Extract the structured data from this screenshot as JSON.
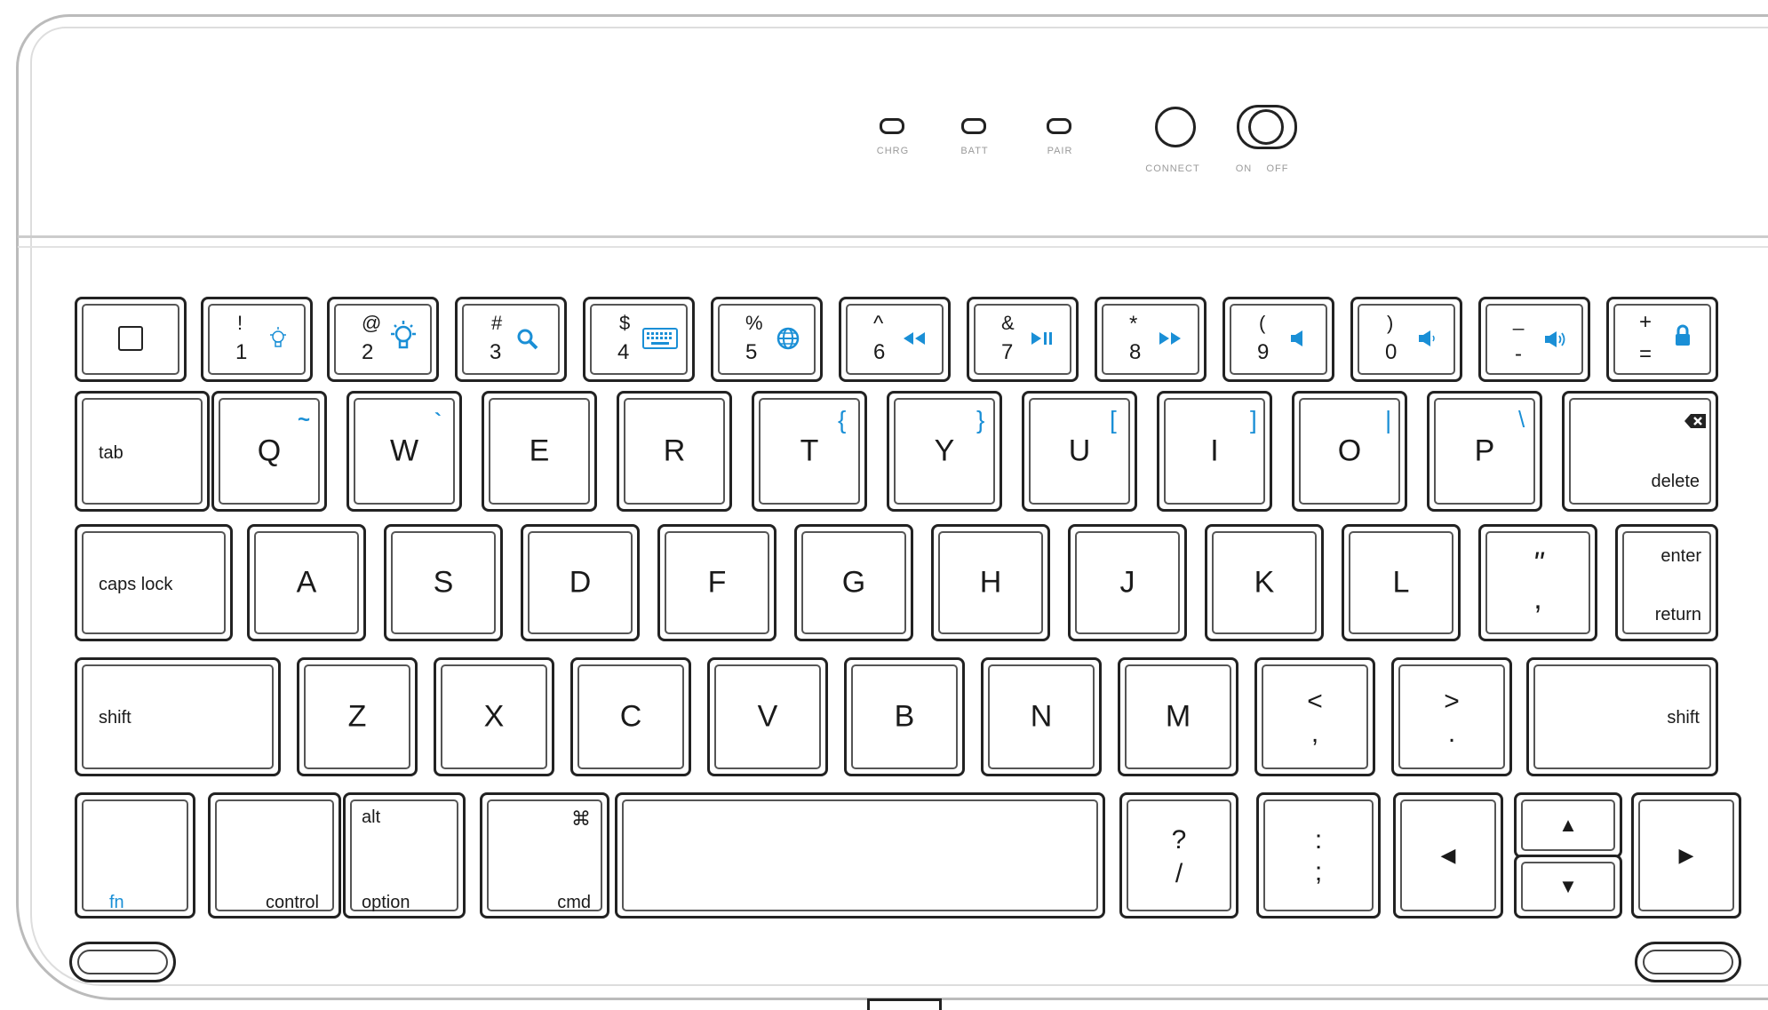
{
  "status_panel": {
    "leds": [
      {
        "label": "CHRG"
      },
      {
        "label": "BATT"
      },
      {
        "label": "PAIR"
      }
    ],
    "connect_label": "CONNECT",
    "power_on_label": "ON",
    "power_off_label": "OFF"
  },
  "colors": {
    "key_outline": "#222222",
    "blue_function": "#1a8fd6",
    "label_gray": "#9a9a9a"
  },
  "keys": {
    "home": {
      "icon": "home-square-icon"
    },
    "k1": {
      "top": "!",
      "bottom": "1",
      "fn_icon": "brightness-down-icon"
    },
    "k2": {
      "top": "@",
      "bottom": "2",
      "fn_icon": "brightness-up-icon"
    },
    "k3": {
      "top": "#",
      "bottom": "3",
      "fn_icon": "search-icon"
    },
    "k4": {
      "top": "$",
      "bottom": "4",
      "fn_icon": "keyboard-icon"
    },
    "k5": {
      "top": "%",
      "bottom": "5",
      "fn_icon": "globe-icon"
    },
    "k6": {
      "top": "^",
      "bottom": "6",
      "fn_icon": "rewind-icon"
    },
    "k7": {
      "top": "&",
      "bottom": "7",
      "fn_icon": "play-pause-icon"
    },
    "k8": {
      "top": "*",
      "bottom": "8",
      "fn_icon": "fast-forward-icon"
    },
    "k9": {
      "top": "(",
      "bottom": "9",
      "fn_icon": "mute-icon"
    },
    "k0": {
      "top": ")",
      "bottom": "0",
      "fn_icon": "volume-down-icon"
    },
    "kminus": {
      "top": "_",
      "bottom": "-",
      "fn_icon": "volume-up-icon"
    },
    "kplus": {
      "top": "+",
      "bottom": "=",
      "fn_icon": "lock-icon"
    },
    "tab": "tab",
    "q": {
      "label": "Q",
      "fn": "~"
    },
    "w": {
      "label": "W",
      "fn": "`"
    },
    "e": {
      "label": "E"
    },
    "r": {
      "label": "R"
    },
    "t": {
      "label": "T",
      "fn": "{"
    },
    "y": {
      "label": "Y",
      "fn": "}"
    },
    "u": {
      "label": "U",
      "fn": "["
    },
    "i": {
      "label": "I",
      "fn": "]"
    },
    "o": {
      "label": "O",
      "fn": "|"
    },
    "p": {
      "label": "P",
      "fn": "\\"
    },
    "delete": "delete",
    "caps": "caps lock",
    "a": "A",
    "s": "S",
    "d": "D",
    "f": "F",
    "g": "G",
    "h": "H",
    "j": "J",
    "k": "K",
    "l": "L",
    "quote": {
      "top": "\"",
      "bottom": ","
    },
    "enter": {
      "top": "enter",
      "bottom": "return"
    },
    "shift_left": "shift",
    "z": "Z",
    "x": "X",
    "c": "C",
    "v": "V",
    "b": "B",
    "n": "N",
    "m": "M",
    "comma": {
      "top": "<",
      "bottom": ","
    },
    "period": {
      "top": ">",
      "bottom": "."
    },
    "shift_right": "shift",
    "fn": "fn",
    "control": "control",
    "option": {
      "top": "alt",
      "bottom": "option"
    },
    "cmd": {
      "top": "⌘",
      "bottom": "cmd"
    },
    "slash": {
      "top": "?",
      "bottom": "/"
    },
    "semicolon": {
      "top": ":",
      "bottom": ";"
    },
    "left": "◀",
    "up": "▲",
    "down": "▼",
    "right": "▶"
  }
}
